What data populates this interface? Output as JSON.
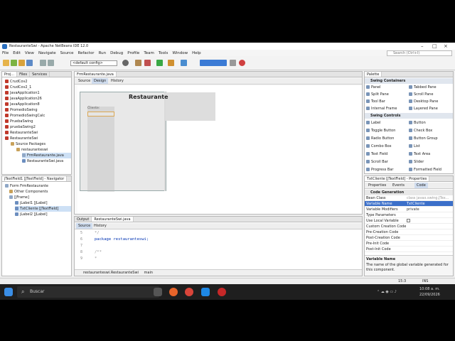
{
  "window": {
    "title": "RestauranteSwi - Apache NetBeans IDE 12.0"
  },
  "menu": [
    "File",
    "Edit",
    "View",
    "Navigate",
    "Source",
    "Refactor",
    "Run",
    "Debug",
    "Profile",
    "Team",
    "Tools",
    "Window",
    "Help"
  ],
  "search": {
    "placeholder": "Search (Ctrl+I)"
  },
  "toolbar": {
    "config": "<default config>"
  },
  "projects": {
    "tabs": [
      "Proj...",
      "Files",
      "Services"
    ],
    "items": [
      "CrudCov2",
      "CrudCov2_1",
      "JavaApplication1",
      "JavaApplication26",
      "JavaApplication8",
      "PromedioSwing",
      "PromedioSwingCalc",
      "PruebaSwing",
      "pruebaSwing2",
      "RestauranteSwi",
      "RestauranteSwi",
      "Source Packages",
      "restauranteswi",
      "FrmRestaurante.java",
      "RestauranteSwi.java"
    ]
  },
  "navigator": {
    "title": "jTextField1 [JTextField] - Navigator",
    "items": [
      "Form FrmRestaurante",
      "Other Components",
      "[JFrame]",
      "jLabel1 [JLabel]",
      "TxtCliente [JTextField]",
      "jLabel2 [JLabel]"
    ]
  },
  "editor": {
    "tab": "FrmRestaurante.java",
    "subtabs": [
      "Source",
      "Design",
      "History"
    ],
    "form_title": "Restaurante",
    "form_label": "Cliente:"
  },
  "output": {
    "tabs": [
      "Output",
      "RestauranteSwi.java"
    ],
    "subtabs": [
      "Source",
      "History"
    ],
    "line_numbers": [
      "5",
      "6",
      "7",
      "8",
      "9"
    ],
    "lines": [
      "*/",
      "package restauranteswi;",
      "",
      "/**",
      " *"
    ],
    "breadcrumb": [
      "restauranteswi.RestauranteSwi",
      "main"
    ]
  },
  "palette": {
    "title": "Palette",
    "sections": [
      "Swing Containers",
      "Swing Controls"
    ],
    "containers": [
      "Panel",
      "Tabbed Pane",
      "Split Pane",
      "Scroll Pane",
      "Tool Bar",
      "Desktop Pane",
      "Internal Frame",
      "Layered Pane"
    ],
    "controls": [
      "Label",
      "Button",
      "Toggle Button",
      "Check Box",
      "Radio Button",
      "Button Group",
      "Combo Box",
      "List",
      "Text Field",
      "Text Area",
      "Scroll Bar",
      "Slider",
      "Progress Bar",
      "Formatted Field"
    ]
  },
  "properties": {
    "title": "TxtCliente [JTextField] - Properties",
    "tabs": [
      "Properties",
      "Events",
      "Code"
    ],
    "section": "Code Generation",
    "rows": [
      {
        "k": "Bean Class",
        "v": "class javax.swing.JTex..."
      },
      {
        "k": "Variable Name",
        "v": "TxtCliente"
      },
      {
        "k": "Variable Modifiers",
        "v": "private"
      },
      {
        "k": "Type Parameters",
        "v": ""
      },
      {
        "k": "Use Local Variable",
        "v": ""
      },
      {
        "k": "Custom Creation Code",
        "v": ""
      },
      {
        "k": "Pre-Creation Code",
        "v": ""
      },
      {
        "k": "Post-Creation Code",
        "v": ""
      },
      {
        "k": "Pre-Init Code",
        "v": ""
      },
      {
        "k": "Post-Init Code",
        "v": ""
      }
    ],
    "desc_title": "Variable Name",
    "desc_text": "The name of the global variable generated for this component."
  },
  "status": {
    "pos": "15:3",
    "mode": "INS"
  },
  "taskbar": {
    "search": "Buscar",
    "time": "10:08 a. m.",
    "date": "22/09/2026"
  },
  "colors": {
    "accent": "#3b6fc9",
    "taskbar": "#1f1f1f"
  }
}
